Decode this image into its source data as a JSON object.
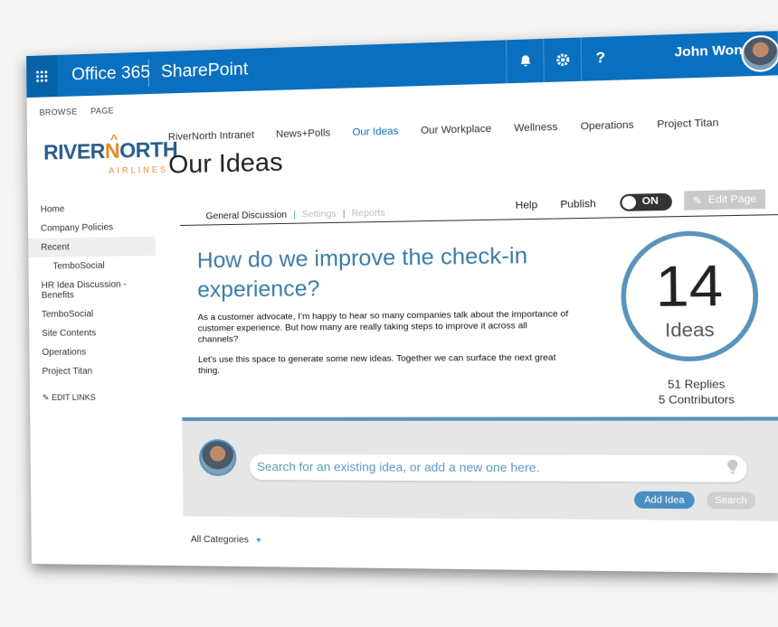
{
  "suite": {
    "brand": "Office 365",
    "product": "SharePoint",
    "user_name": "John Wong",
    "help_glyph": "?",
    "icons": [
      "app-launcher-icon",
      "bell-icon",
      "gear-icon",
      "help-icon"
    ],
    "accent": "#0a6fbe"
  },
  "ribbon": {
    "browse": "BROWSE",
    "page": "PAGE"
  },
  "logo": {
    "line1_a": "RIVER",
    "line1_o": "N",
    "line1_b": "ORTH",
    "line2": "AIRLINES",
    "caret": "^"
  },
  "topnav": [
    "RiverNorth Intranet",
    "News+Polls",
    "Our Ideas",
    "Our Workplace",
    "Wellness",
    "Operations",
    "Project Titan"
  ],
  "page_title": "Our Ideas",
  "leftnav": {
    "items": [
      "Home",
      "Company Policies",
      "Recent",
      "TemboSocial",
      "HR Idea Discussion - Benefits",
      "TemboSocial",
      "Site Contents",
      "Operations",
      "Project Titan"
    ],
    "edit_links": "EDIT LINKS"
  },
  "tabs": {
    "general": "General Discussion",
    "settings": "Settings",
    "reports": "Reports",
    "separator": "|"
  },
  "page_actions": {
    "help": "Help",
    "publish": "Publish",
    "toggle_state": "ON",
    "edit_page": "Edit Page"
  },
  "headline": "How do we improve the check-in experience?",
  "body": {
    "p1": "As a customer advocate, I’m happy to hear so many companies talk about the importance of customer experience. But how many are really taking steps to improve it across all channels?",
    "p2": "Let’s use this space to generate some new ideas. Together we can surface the next great thing."
  },
  "stats": {
    "ideas_count": "14",
    "ideas_label": "Ideas",
    "replies": "51 Replies",
    "contributors": "5 Contributors"
  },
  "search": {
    "placeholder": "Search for an existing idea, or add a new one here.",
    "add_button": "Add Idea",
    "search_button": "Search"
  },
  "filter": {
    "categories": "All Categories",
    "chevron": "▼"
  }
}
